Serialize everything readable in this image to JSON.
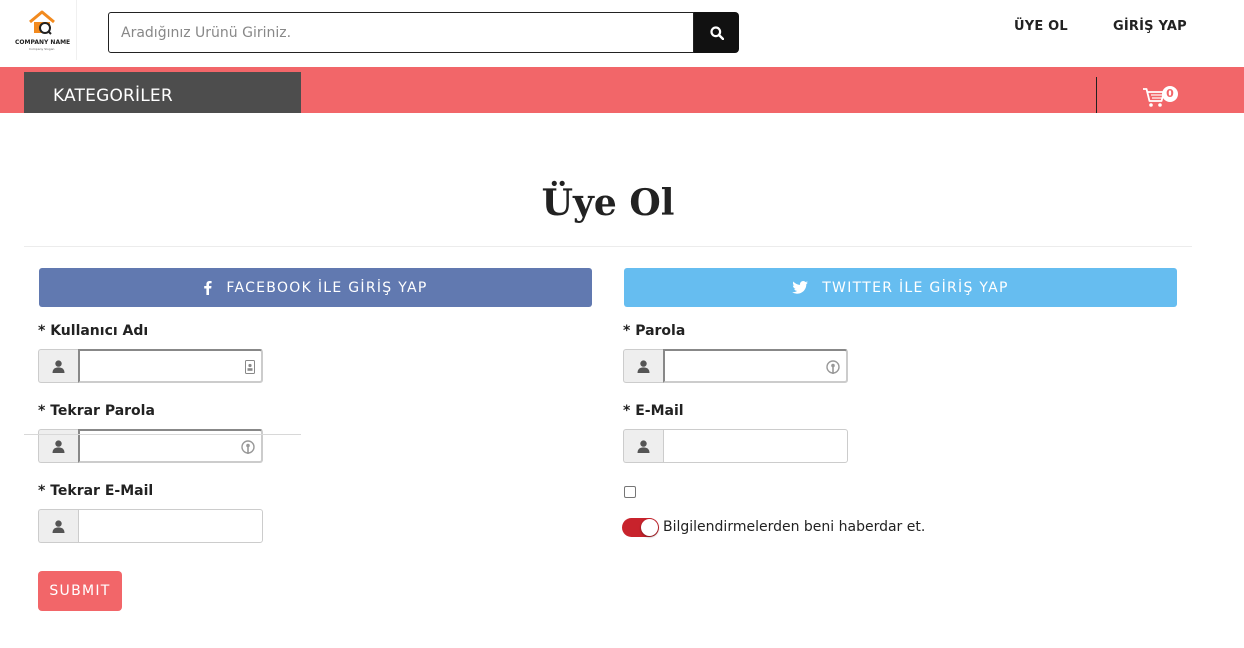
{
  "logo": {
    "company": "COMPANY NAME",
    "tagline": "Company Slogan"
  },
  "search": {
    "placeholder": "Aradığınız Ürünü Giriniz.",
    "icon": "search-icon"
  },
  "nav": {
    "register": "ÜYE OL",
    "login": "GİRİŞ YAP"
  },
  "categories": {
    "label": "KATEGORİLER"
  },
  "cart": {
    "count": "0",
    "icon": "cart-icon"
  },
  "page": {
    "title": "Üye Ol"
  },
  "social": {
    "facebook": "FACEBOOK İLE GİRİŞ YAP",
    "twitter": "TWITTER İLE GİRİŞ YAP"
  },
  "form": {
    "username_label": "* Kullanıcı Adı",
    "repeat_password_label": "* Tekrar Parola",
    "repeat_email_label": "* Tekrar E-Mail",
    "password_label": "* Parola",
    "email_label": "* E-Mail",
    "notify_label": "Bilgilendirmelerden beni haberdar et.",
    "submit": "SUBMIT"
  },
  "colors": {
    "accent": "#f26669",
    "facebook": "#6179b0",
    "twitter": "#66bdf0",
    "toggle_on": "#c8232c"
  }
}
